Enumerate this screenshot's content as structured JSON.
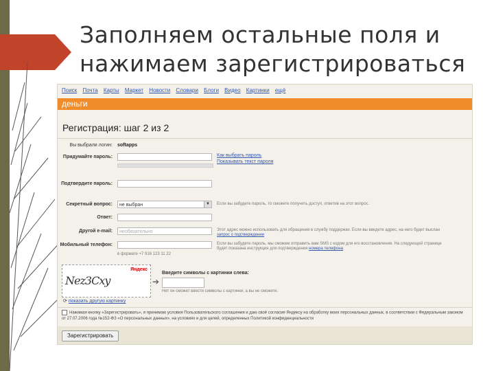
{
  "slide": {
    "title_line1": "Заполняем остальные поля и",
    "title_line2": "нажимаем зарегистрироваться"
  },
  "nav": {
    "items": [
      "Поиск",
      "Почта",
      "Карты",
      "Маркет",
      "Новости",
      "Словари",
      "Блоги",
      "Видео",
      "Картинки",
      "ещё"
    ]
  },
  "service_bar": {
    "label": "деньги",
    "color": "#f08c2a"
  },
  "page": {
    "heading": "Регистрация: шаг 2 из 2"
  },
  "form": {
    "login_label": "Вы выбрали логин:",
    "login_value": "softapps",
    "password_label": "Придумайте пароль:",
    "password_link1": "Как выбрать пароль",
    "password_link2": "Показывать текст пароля",
    "confirm_label": "Подтвердите пароль:",
    "secret_label": "Секретный вопрос:",
    "secret_value": "не выбран",
    "secret_hint": "Если вы забудете пароль, то сможете получить доступ, ответив на этот вопрос.",
    "answer_label": "Ответ:",
    "email_label": "Другой e-mail:",
    "email_placeholder": "необязательно",
    "email_hint": "Этот адрес можно использовать для обращения в службу поддержки. Если вы введете адрес, на него будет выслан",
    "email_link": "запрос о подтверждении",
    "phone_label": "Мобильный телефон:",
    "phone_hint": "Если вы забудете пароль, мы сможем отправить вам SMS с кодом для его восстановления. На следующей странице",
    "phone_hint2": "будет показана инструкция для подтверждения",
    "phone_hint_link": "номера телефона",
    "phone_format": "в формате +7 916 123 11 22"
  },
  "captcha": {
    "brand": "Яндекс",
    "text": "Nez3Cxy",
    "label": "Введите символы с картинки слева:",
    "hint": "Нет он сможет ввести символы с картинки, а вы не сможете.",
    "refresh_link": "показать другую картинку"
  },
  "agreement": {
    "text": "Нажимая кнопку «Зарегистрировать», я принимаю условия Пользовательского соглашения и даю своё согласие Яндексу на обработку моих персональных данных, в соответствии с Федеральным законом от 27.07.2006 года №152-ФЗ «О персональных данных», на условиях и для целей, определенных Политикой конфиденциальности"
  },
  "submit": {
    "label": "Зарегистрировать"
  }
}
